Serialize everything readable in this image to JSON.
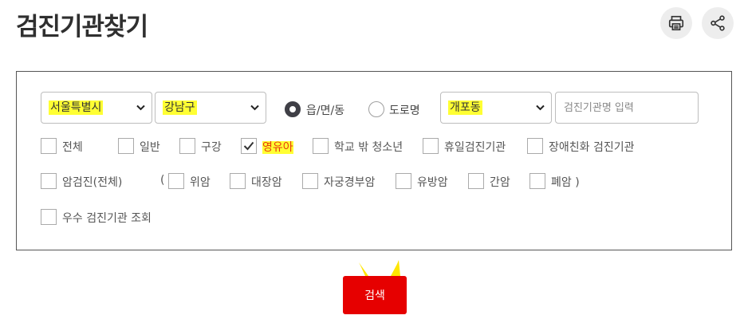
{
  "header": {
    "title": "검진기관찾기"
  },
  "icons": {
    "print": "print-icon",
    "share": "share-icon"
  },
  "filters": {
    "sido_select": "서울특별시",
    "gugun_select": "강남구",
    "radio_options": [
      {
        "label": "읍/면/동",
        "selected": true
      },
      {
        "label": "도로명",
        "selected": false
      }
    ],
    "dong_select": "개포동",
    "name_input": {
      "placeholder": "검진기관명 입력",
      "value": ""
    },
    "row1": [
      {
        "label": "전체",
        "checked": false
      },
      {
        "label": "일반",
        "checked": false
      },
      {
        "label": "구강",
        "checked": false
      },
      {
        "label": "영유아",
        "checked": true
      },
      {
        "label": "학교 밖 청소년",
        "checked": false
      },
      {
        "label": "휴일검진기관",
        "checked": false
      },
      {
        "label": "장애친화 검진기관",
        "checked": false
      }
    ],
    "row2": {
      "main": {
        "label": "암검진(전체)",
        "checked": false
      },
      "open_paren": "(",
      "items": [
        {
          "label": "위암",
          "checked": false
        },
        {
          "label": "대장암",
          "checked": false
        },
        {
          "label": "자궁경부암",
          "checked": false
        },
        {
          "label": "유방암",
          "checked": false
        },
        {
          "label": "간암",
          "checked": false
        },
        {
          "label": "폐암 )",
          "checked": false
        }
      ]
    },
    "row3": [
      {
        "label": "우수 검진기관 조회",
        "checked": false
      }
    ]
  },
  "search_button": "검색",
  "colors": {
    "accent": "#e60000",
    "highlight": "#ffff33",
    "dark": "#3f3f46"
  }
}
